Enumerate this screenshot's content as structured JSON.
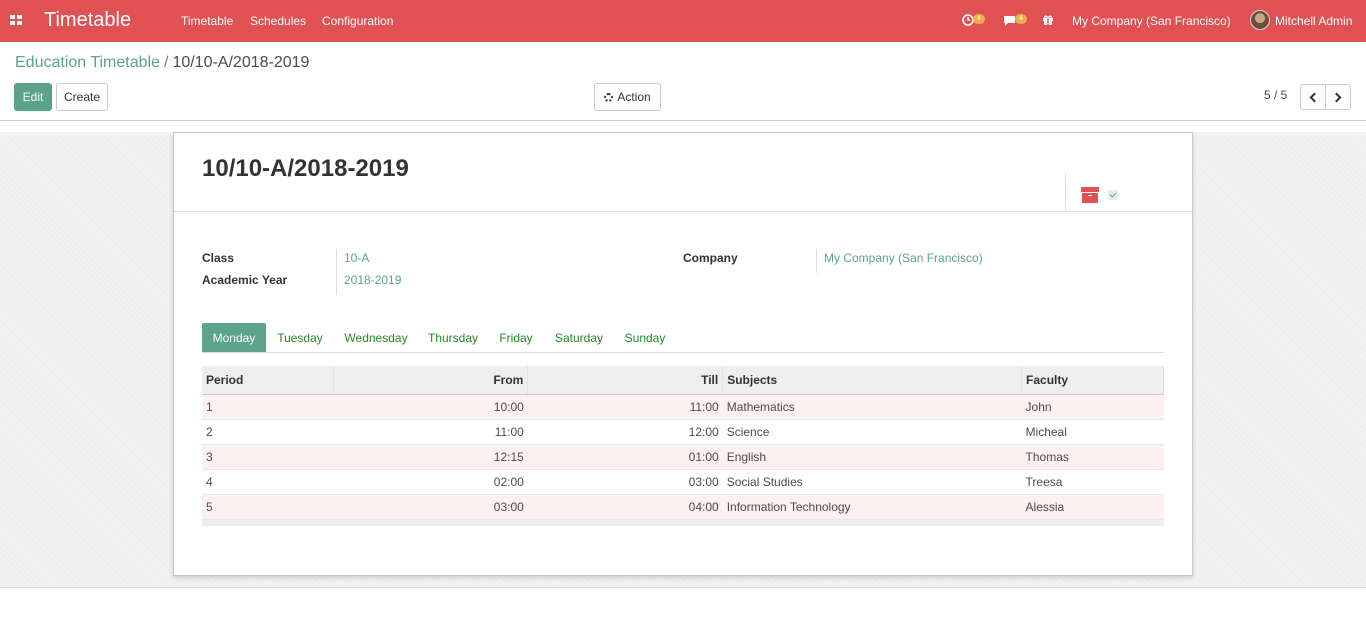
{
  "navbar": {
    "app_name": "Timetable",
    "menus": [
      "Timetable",
      "Schedules",
      "Configuration"
    ],
    "activity_count": "4",
    "message_count": "4",
    "company": "My Company (San Francisco)",
    "user": "Mitchell Admin",
    "color": "#e05153"
  },
  "breadcrumb": {
    "parent": "Education Timetable",
    "separator": "/",
    "current": "10/10-A/2018-2019"
  },
  "buttons": {
    "edit": "Edit",
    "create": "Create",
    "action": "Action"
  },
  "pager": {
    "value": "5 / 5"
  },
  "record": {
    "title": "10/10-A/2018-2019",
    "fields": {
      "class_label": "Class",
      "class_value": "10-A",
      "year_label": "Academic Year",
      "year_value": "2018-2019",
      "company_label": "Company",
      "company_value": "My Company (San Francisco)"
    }
  },
  "tabs": {
    "days": [
      "Monday",
      "Tuesday",
      "Wednesday",
      "Thursday",
      "Friday",
      "Saturday",
      "Sunday"
    ],
    "active": "Monday"
  },
  "table": {
    "headers": [
      "Period",
      "From",
      "Till",
      "Subjects",
      "Faculty"
    ],
    "rows": [
      [
        "1",
        "10:00",
        "11:00",
        "Mathematics",
        "John"
      ],
      [
        "2",
        "11:00",
        "12:00",
        "Science",
        "Micheal"
      ],
      [
        "3",
        "12:15",
        "01:00",
        "English",
        "Thomas"
      ],
      [
        "4",
        "02:00",
        "03:00",
        "Social Studies",
        "Treesa"
      ],
      [
        "5",
        "03:00",
        "04:00",
        "Information Technology",
        "Alessia"
      ]
    ]
  },
  "icons": {
    "apps": "apps-grid-icon",
    "activity": "clock-icon",
    "messages": "chat-icon",
    "gift": "gift-icon",
    "archive": "archive-icon",
    "active_toggle": "check-icon",
    "prev": "chevron-left-icon",
    "next": "chevron-right-icon",
    "action": "gear-icon"
  },
  "colors": {
    "primary": "#5ba38b",
    "navbar": "#e05153",
    "tab_link": "#228b22"
  }
}
